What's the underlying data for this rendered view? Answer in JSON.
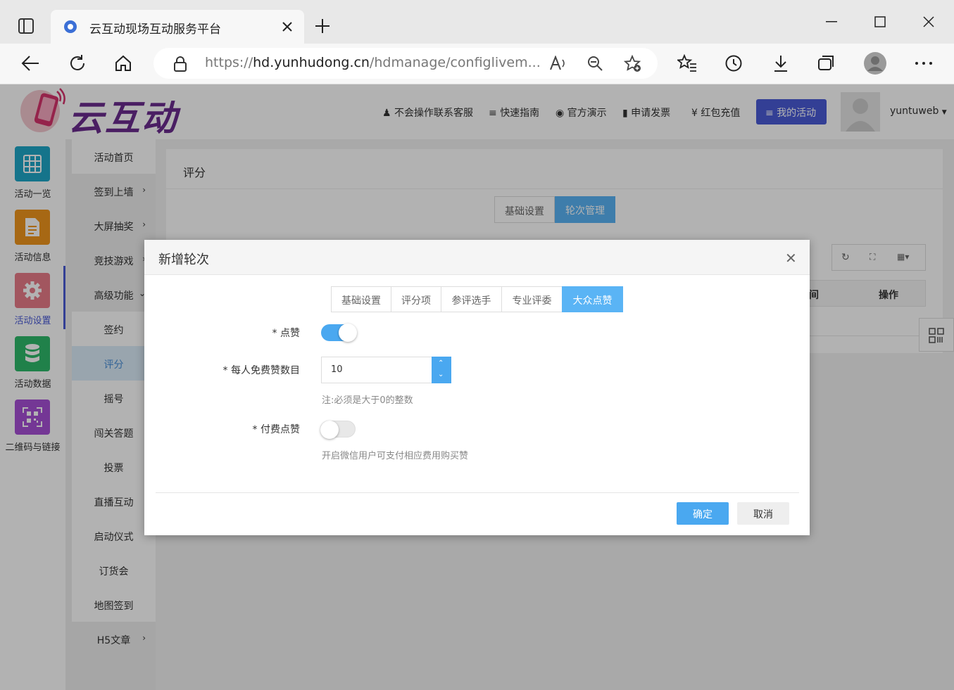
{
  "browser": {
    "tab_title": "云互动现场互动服务平台",
    "url_prefix": "https://",
    "url_host": "hd.yunhudong.cn",
    "url_path": "/hdmanage/configlivem..."
  },
  "header": {
    "logo_text": "云互动",
    "nav": [
      "不会操作联系客服",
      "快速指南",
      "官方演示",
      "申请发票",
      "红包充值"
    ],
    "my_activity": "我的活动",
    "username": "yuntuweb"
  },
  "iconbar": [
    {
      "label": "活动一览",
      "color": "#1fa6c8",
      "icon": "grid-icon"
    },
    {
      "label": "活动信息",
      "color": "#f0961e",
      "icon": "document-icon"
    },
    {
      "label": "活动设置",
      "color": "#e97b88",
      "icon": "gear-icon",
      "active": true
    },
    {
      "label": "活动数据",
      "color": "#2eb96b",
      "icon": "database-icon"
    },
    {
      "label": "二维码与链接",
      "color": "#a64fd6",
      "icon": "qrcode-icon"
    }
  ],
  "submenu": [
    "活动首页",
    "签到上墙",
    "大屏抽奖",
    "竞技游戏",
    "高级功能",
    "签约",
    "评分",
    "摇号",
    "闯关答题",
    "投票",
    "直播互动",
    "启动仪式",
    "订货会",
    "地图签到",
    "H5文章"
  ],
  "page": {
    "title": "评分",
    "tabs": [
      "基础设置",
      "轮次管理"
    ],
    "table_headers": [
      "间",
      "操作"
    ]
  },
  "modal": {
    "title": "新增轮次",
    "tabs": [
      "基础设置",
      "评分项",
      "参评选手",
      "专业评委",
      "大众点赞"
    ],
    "like_label": "* 点赞",
    "like_on": true,
    "free_label": "* 每人免费赞数目",
    "free_value": "10",
    "free_note": "注:必须是大于0的整数",
    "paid_label": "* 付费点赞",
    "paid_on": false,
    "paid_note": "开启微信用户可支付相应费用购买赞",
    "confirm": "确定",
    "cancel": "取消"
  },
  "colors": {
    "accent": "#5ab4f5",
    "brand": "#4a5bd6"
  }
}
